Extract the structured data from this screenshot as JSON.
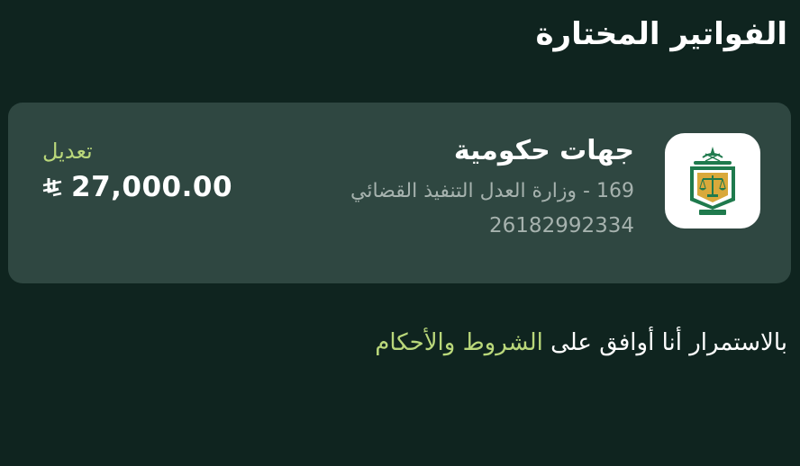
{
  "header": {
    "title": "الفواتير المختارة"
  },
  "bill": {
    "name": "جهات حكومية",
    "description": "169 - وزارة العدل التنفيذ القضائي",
    "number": "26182992334",
    "edit_label": "تعديل",
    "amount": "27,000.00",
    "logo_icon": "ministry-of-justice-logo",
    "currency_icon": "saudi-riyal-icon"
  },
  "terms": {
    "prefix": "بالاستمرار أنا أوافق على",
    "link_label": "الشروط والأحكام"
  },
  "colors": {
    "background": "#0f241f",
    "card": "#2f4741",
    "accent": "#b9d77a",
    "secondary_text": "#a6b2ae",
    "logo_green": "#1f7a4d",
    "logo_gold": "#d9a93b"
  }
}
